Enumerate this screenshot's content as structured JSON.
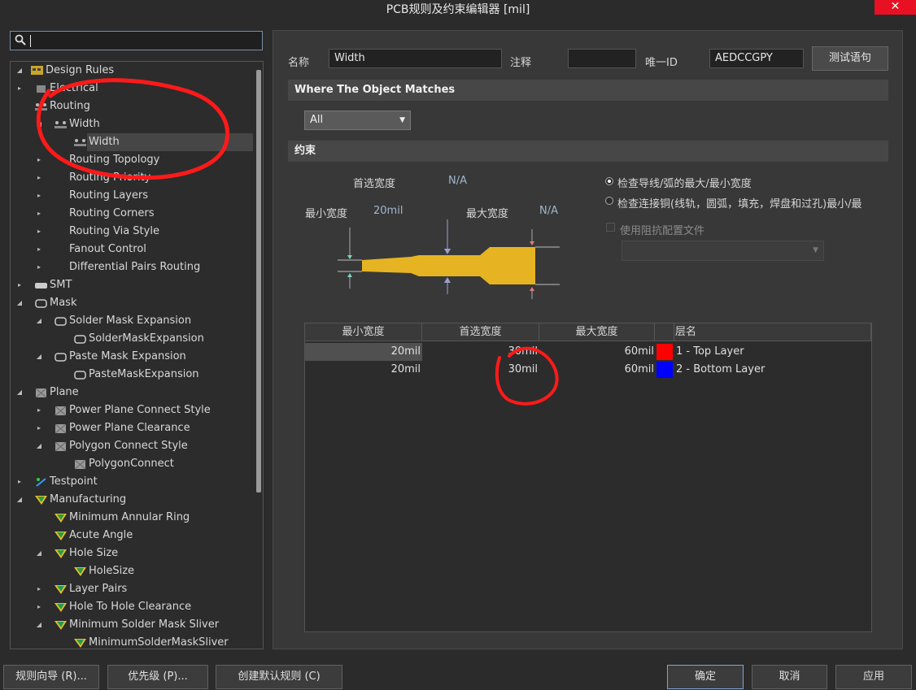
{
  "window": {
    "title": "PCB规则及约束编辑器 [mil]",
    "close_glyph": "✕"
  },
  "tree": {
    "root": "Design Rules",
    "items": [
      {
        "label": "Electrical",
        "depth": 1,
        "arrow": "▸",
        "icon": "electrical-icon"
      },
      {
        "label": "Routing",
        "depth": 1,
        "arrow": "",
        "icon": "routing-icon"
      },
      {
        "label": "Width",
        "depth": 2,
        "arrow": "◂",
        "icon": "routing-icon"
      },
      {
        "label": "Width",
        "depth": 3,
        "arrow": "",
        "icon": "routing-icon",
        "selected": true
      },
      {
        "label": "Routing Topology",
        "depth": 2,
        "arrow": "▸",
        "icon": ""
      },
      {
        "label": "Routing Priority",
        "depth": 2,
        "arrow": "▸",
        "icon": ""
      },
      {
        "label": "Routing Layers",
        "depth": 2,
        "arrow": "▸",
        "icon": ""
      },
      {
        "label": "Routing Corners",
        "depth": 2,
        "arrow": "▸",
        "icon": ""
      },
      {
        "label": "Routing Via Style",
        "depth": 2,
        "arrow": "▸",
        "icon": ""
      },
      {
        "label": "Fanout Control",
        "depth": 2,
        "arrow": "▸",
        "icon": ""
      },
      {
        "label": "Differential Pairs Routing",
        "depth": 2,
        "arrow": "▸",
        "icon": ""
      },
      {
        "label": "SMT",
        "depth": 1,
        "arrow": "▸",
        "icon": "smt-icon"
      },
      {
        "label": "Mask",
        "depth": 1,
        "arrow": "◂",
        "icon": "mask-icon"
      },
      {
        "label": "Solder Mask Expansion",
        "depth": 2,
        "arrow": "◂",
        "icon": "mask-icon"
      },
      {
        "label": "SolderMaskExpansion",
        "depth": 3,
        "arrow": "",
        "icon": "mask-icon"
      },
      {
        "label": "Paste Mask Expansion",
        "depth": 2,
        "arrow": "◂",
        "icon": "mask-icon"
      },
      {
        "label": "PasteMaskExpansion",
        "depth": 3,
        "arrow": "",
        "icon": "mask-icon"
      },
      {
        "label": "Plane",
        "depth": 1,
        "arrow": "◂",
        "icon": "plane-icon"
      },
      {
        "label": "Power Plane Connect Style",
        "depth": 2,
        "arrow": "▸",
        "icon": "plane-icon"
      },
      {
        "label": "Power Plane Clearance",
        "depth": 2,
        "arrow": "▸",
        "icon": "plane-icon"
      },
      {
        "label": "Polygon Connect Style",
        "depth": 2,
        "arrow": "◂",
        "icon": "plane-icon"
      },
      {
        "label": "PolygonConnect",
        "depth": 3,
        "arrow": "",
        "icon": "plane-icon"
      },
      {
        "label": "Testpoint",
        "depth": 1,
        "arrow": "▸",
        "icon": "testpoint-icon"
      },
      {
        "label": "Manufacturing",
        "depth": 1,
        "arrow": "◂",
        "icon": "manufacturing-icon"
      },
      {
        "label": "Minimum Annular Ring",
        "depth": 2,
        "arrow": "",
        "icon": "manufacturing-icon"
      },
      {
        "label": "Acute Angle",
        "depth": 2,
        "arrow": "",
        "icon": "manufacturing-icon"
      },
      {
        "label": "Hole Size",
        "depth": 2,
        "arrow": "◂",
        "icon": "manufacturing-icon"
      },
      {
        "label": "HoleSize",
        "depth": 3,
        "arrow": "",
        "icon": "manufacturing-icon"
      },
      {
        "label": "Layer Pairs",
        "depth": 2,
        "arrow": "▸",
        "icon": "manufacturing-icon"
      },
      {
        "label": "Hole To Hole Clearance",
        "depth": 2,
        "arrow": "▸",
        "icon": "manufacturing-icon"
      },
      {
        "label": "Minimum Solder Mask Sliver",
        "depth": 2,
        "arrow": "◂",
        "icon": "manufacturing-icon"
      },
      {
        "label": "MinimumSolderMaskSliver",
        "depth": 3,
        "arrow": "",
        "icon": "manufacturing-icon"
      }
    ]
  },
  "header": {
    "name_label": "名称",
    "name_value": "Width",
    "comment_label": "注释",
    "comment_value": "",
    "id_label": "唯一ID",
    "id_value": "AEDCCGPY",
    "test_button": "测试语句"
  },
  "where": {
    "title": "Where The Object Matches",
    "dropdown_value": "All"
  },
  "constraints": {
    "title": "约束",
    "preferred_label": "首选宽度",
    "preferred_value": "N/A",
    "min_label": "最小宽度",
    "min_value": "20mil",
    "max_label": "最大宽度",
    "max_value": "N/A",
    "radio1": "检查导线/弧的最大/最小宽度",
    "radio2": "检查连接铜(线轨，圆弧，填充，焊盘和过孔)最小/最",
    "impedance_label": "使用阻抗配置文件",
    "track_color": "#e6b422"
  },
  "table": {
    "headers": [
      "最小宽度",
      "首选宽度",
      "最大宽度",
      "",
      "层名"
    ],
    "rows": [
      {
        "min": "20mil",
        "pref": "30mil",
        "max": "60mil",
        "color": "#ff0000",
        "layer": "1 - Top Layer"
      },
      {
        "min": "20mil",
        "pref": "30mil",
        "max": "60mil",
        "color": "#0000ff",
        "layer": "2 - Bottom Layer"
      }
    ]
  },
  "footer": {
    "wizard": "规则向导 (R)...",
    "priority": "优先级 (P)...",
    "default_rules": "创建默认规则 (C)",
    "ok": "确定",
    "cancel": "取消",
    "apply": "应用"
  }
}
